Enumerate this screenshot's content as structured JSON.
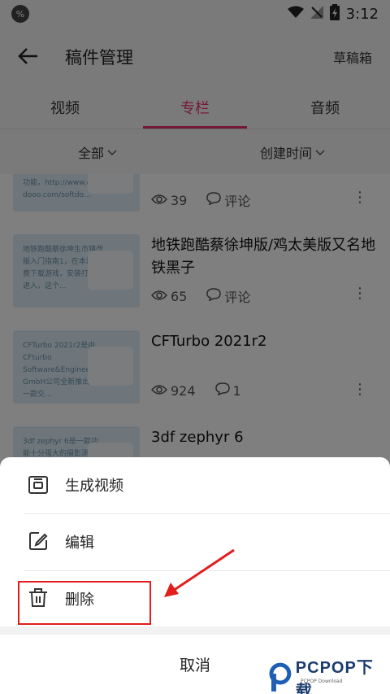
{
  "status_bar": {
    "time": "3:12"
  },
  "header": {
    "title": "稿件管理",
    "drafts_label": "草稿箱"
  },
  "tabs": [
    {
      "label": "视频"
    },
    {
      "label": "专栏"
    },
    {
      "label": "音频"
    }
  ],
  "filters": {
    "category": "全部",
    "sort": "创建时间"
  },
  "articles": [
    {
      "thumb_text": "功能，http://www.d... dooo.com/softdo...",
      "title": "",
      "views": "39",
      "comments": "评论"
    },
    {
      "thumb_text": "地铁跑酷蔡徐坤生市镇改版入门指南1，在本站免费下载游戏，安装打开后进入，这个...",
      "title": "地铁跑酷蔡徐坤版/鸡太美版又名地铁黑子",
      "views": "65",
      "comments": "评论"
    },
    {
      "thumb_text": "CFTurbo 2021r2是由CFturbo Software&Engineering GmbH公司全新推出的一款交...",
      "title": "CFTurbo 2021r2",
      "views": "924",
      "comments": "1"
    },
    {
      "thumb_text": "3df zephyr 6是一款功能十分强大的摄影测量",
      "title": "3df zephyr 6",
      "views": "",
      "comments": ""
    }
  ],
  "sheet": {
    "items": [
      {
        "label": "生成视频",
        "icon": "video-frame-icon"
      },
      {
        "label": "编辑",
        "icon": "edit-icon"
      },
      {
        "label": "删除",
        "icon": "trash-icon"
      }
    ],
    "cancel_label": "取消"
  },
  "watermark": {
    "text": "PCPOP下载",
    "sub": "PCPOP Download"
  },
  "colors": {
    "accent": "#e8336b",
    "highlight": "#e11d1d"
  }
}
